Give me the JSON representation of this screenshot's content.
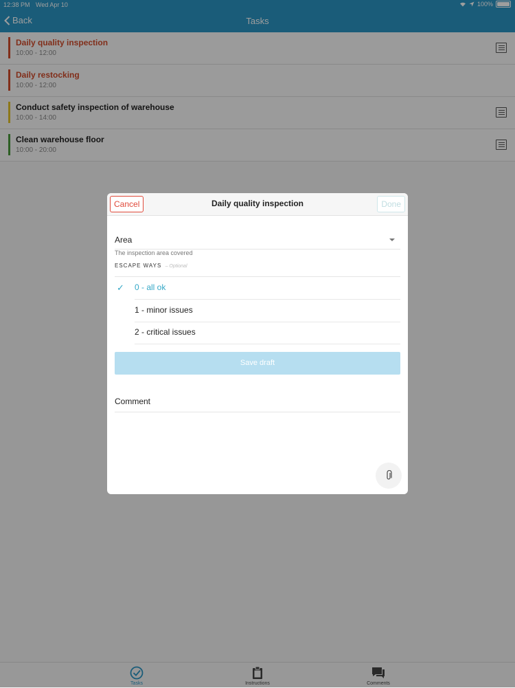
{
  "status": {
    "time": "12:38 PM",
    "date": "Wed Apr 10",
    "battery": "100%"
  },
  "nav": {
    "back_label": "Back",
    "title": "Tasks"
  },
  "tasks": [
    {
      "title": "Daily quality inspection",
      "time": "10:00 - 12:00",
      "color": "#d14b2a",
      "title_color": "#d14b2a",
      "has_list_icon": true
    },
    {
      "title": "Daily restocking",
      "time": "10:00 - 12:00",
      "color": "#d14b2a",
      "title_color": "#d14b2a",
      "has_list_icon": false
    },
    {
      "title": "Conduct safety inspection of warehouse",
      "time": "10:00 - 14:00",
      "color": "#e3c22a",
      "title_color": "#222222",
      "has_list_icon": true
    },
    {
      "title": "Clean warehouse floor",
      "time": "10:00 - 20:00",
      "color": "#4a9a3b",
      "title_color": "#222222",
      "has_list_icon": true
    }
  ],
  "modal": {
    "cancel_label": "Cancel",
    "title": "Daily quality inspection",
    "done_label": "Done",
    "area_label": "Area",
    "area_help": "The inspection area covered",
    "escape_label": "ESCAPE WAYS",
    "escape_optional": "– Optional",
    "options": [
      {
        "label": "0 - all ok",
        "selected": true
      },
      {
        "label": "1 - minor issues",
        "selected": false
      },
      {
        "label": "2 - critical issues",
        "selected": false
      }
    ],
    "save_draft_label": "Save draft",
    "comment_label": "Comment",
    "attach_icon": "paperclip-icon"
  },
  "tabs": [
    {
      "label": "Tasks",
      "icon": "check-circle-icon",
      "active": true
    },
    {
      "label": "Instructions",
      "icon": "clipboard-icon",
      "active": false
    },
    {
      "label": "Comments",
      "icon": "chat-bubbles-icon",
      "active": false
    }
  ],
  "colors": {
    "accent": "#2a95c4",
    "selected": "#35a8c7",
    "cancel": "#e0493a"
  }
}
